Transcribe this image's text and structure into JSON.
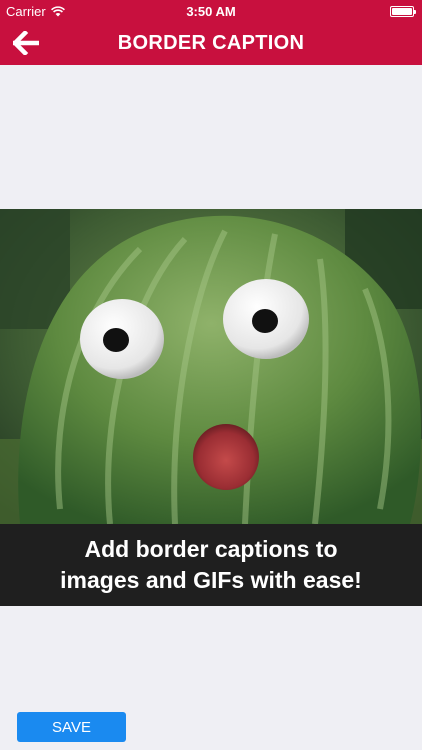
{
  "status_bar": {
    "carrier": "Carrier",
    "time": "3:50 AM",
    "wifi_icon": "wifi-icon",
    "battery_icon": "battery-full-icon"
  },
  "nav_bar": {
    "title": "BORDER CAPTION",
    "back_icon": "arrow-left-icon",
    "background_color": "#c8103e"
  },
  "caption": {
    "line1": "Add border captions to",
    "line2": "images and GIFs with ease!"
  },
  "actions": {
    "save_label": "SAVE",
    "save_color": "#1a8af0"
  }
}
